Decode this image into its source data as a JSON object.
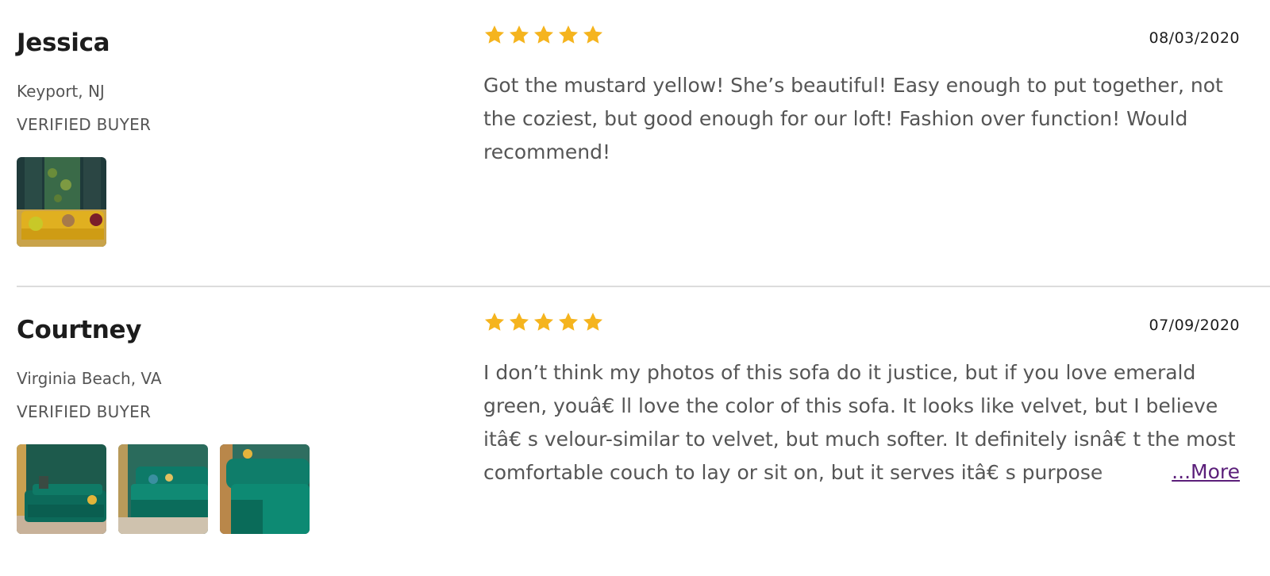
{
  "reviews": [
    {
      "name": "Jessica",
      "location": "Keyport, NJ",
      "verified": "VERIFIED BUYER",
      "rating": 5,
      "date": "08/03/2020",
      "text": "Got the mustard yellow! She’s beautiful! Easy enough to put together, not the coziest, but good enough for our loft! Fashion over function! Would recommend!"
    },
    {
      "name": "Courtney",
      "location": "Virginia Beach, VA",
      "verified": "VERIFIED BUYER",
      "rating": 5,
      "date": "07/09/2020",
      "text": "I don’t think my photos of this sofa do it justice, but if you love emerald green, youâ€   ll love the color of this sofa. It looks like velvet, but I believe itâ€   s velour-similar to velvet, but much softer. It definitely isnâ€   t the most comfortable couch to lay or sit on, but it serves itâ€   s purpose",
      "more_label": "...More"
    }
  ],
  "colors": {
    "star": "#f5b41e",
    "link": "#5b1f7a",
    "divider": "#dcdcdc"
  }
}
